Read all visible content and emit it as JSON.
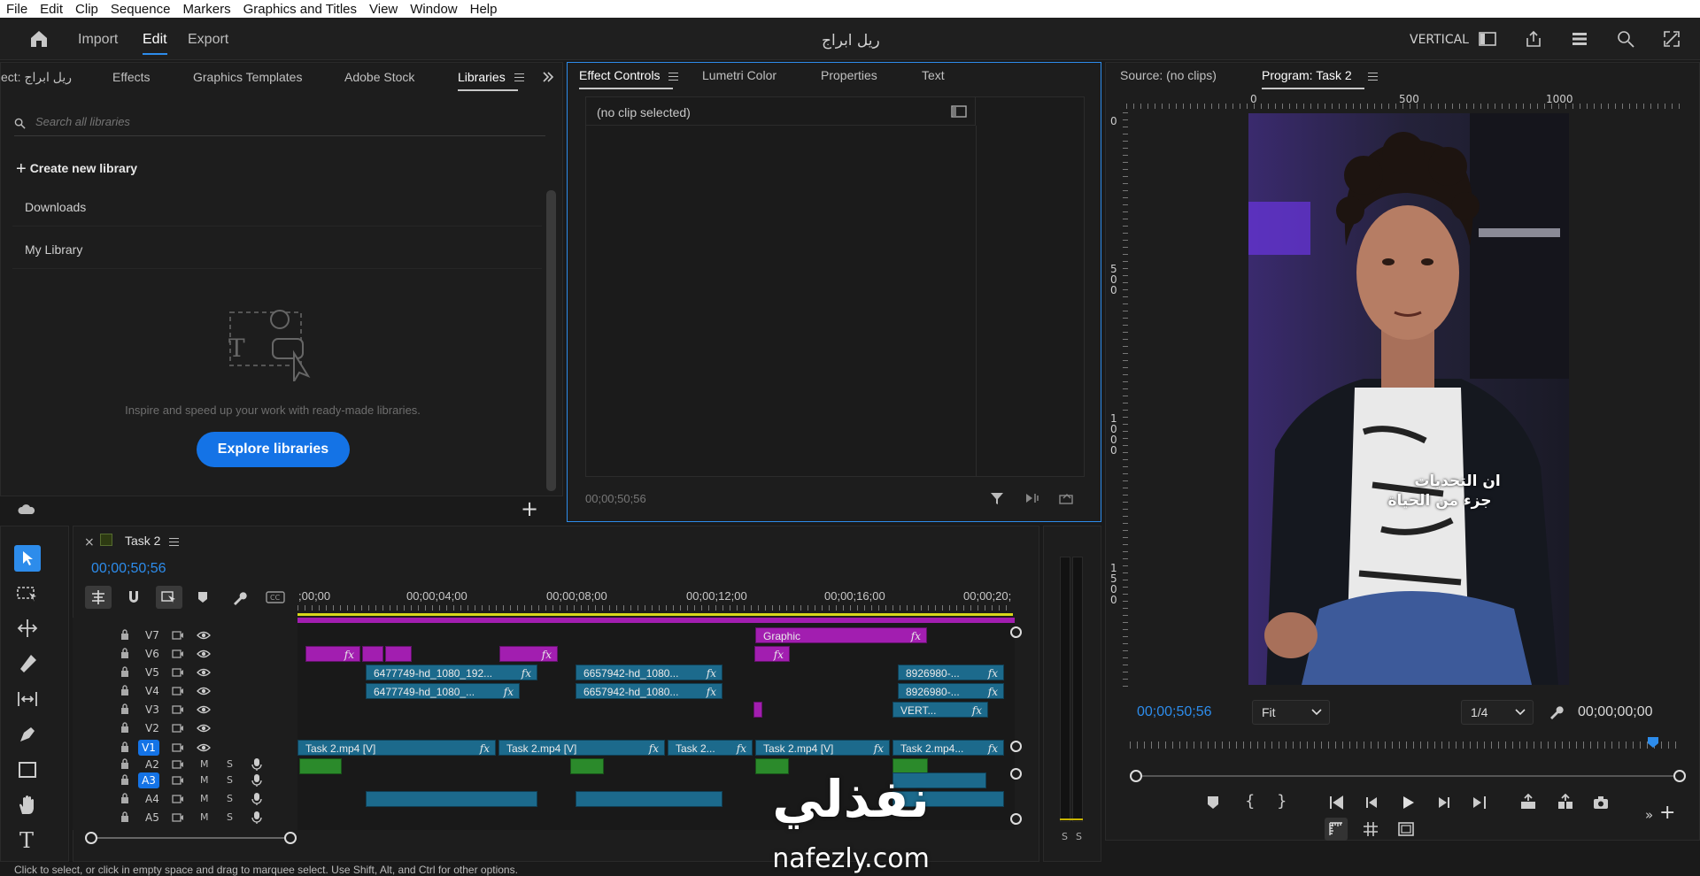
{
  "menu": [
    "File",
    "Edit",
    "Clip",
    "Sequence",
    "Markers",
    "Graphics and Titles",
    "View",
    "Window",
    "Help"
  ],
  "header": {
    "tabs": [
      "Import",
      "Edit",
      "Export"
    ],
    "active_tab": "Edit",
    "project_name": "ريل ابراج",
    "layout_label": "VERTICAL"
  },
  "left_panel": {
    "tabs": [
      "ect: ريل ابراج",
      "Effects",
      "Graphics Templates",
      "Adobe Stock",
      "Libraries"
    ],
    "active_tab": "Libraries",
    "search_placeholder": "Search all libraries",
    "create_label": "Create new library",
    "libraries": [
      "Downloads",
      "My Library"
    ],
    "empty_text": "Inspire and speed up your work with ready-made libraries.",
    "explore_button": "Explore libraries"
  },
  "effect_panel": {
    "tabs": [
      "Effect Controls",
      "Lumetri Color",
      "Properties",
      "Text"
    ],
    "active_tab": "Effect Controls",
    "no_clip": "(no clip selected)",
    "timecode": "00;00;50;56"
  },
  "monitor": {
    "tabs": [
      "Source: (no clips)",
      "Program: Task 2"
    ],
    "active_tab": "Program: Task 2",
    "ruler_h": [
      "0",
      "500",
      "1000"
    ],
    "ruler_v": [
      "0",
      "5\n0\n0",
      "1\n0\n0\n0",
      "1\n5\n0\n0"
    ],
    "caption_line1": "ان التحديات",
    "caption_line2": "جزء من الحياة",
    "current_time": "00;00;50;56",
    "fit": "Fit",
    "resolution": "1/4",
    "duration": "00;00;00;00"
  },
  "timeline": {
    "sequence_name": "Task 2",
    "timecode": "00;00;50;56",
    "ruler": [
      ";00;00",
      "00;00;04;00",
      "00;00;08;00",
      "00;00;12;00",
      "00;00;16;00",
      "00;00;20;"
    ],
    "video_tracks": [
      "V7",
      "V6",
      "V5",
      "V4",
      "V3",
      "V2",
      "V1"
    ],
    "audio_tracks": [
      "A2",
      "A3",
      "A4",
      "A5"
    ],
    "clips": {
      "graphic": "Graphic",
      "v5_a": "6477749-hd_1080_192...",
      "v5_b": "6657942-hd_1080...",
      "v5_c": "8926980-...",
      "v4_a": "6477749-hd_1080_...",
      "v4_b": "6657942-hd_1080...",
      "v4_c": "8926980-...",
      "v3_a": "VERT...",
      "v1_a": "Task 2.mp4 [V]",
      "v1_b": "Task 2.mp4 [V]",
      "v1_c": "Task 2...",
      "v1_d": "Task 2.mp4 [V]",
      "v1_e": "Task 2.mp4...",
      "fx": "fx",
      "m": "M",
      "s": "S"
    },
    "meter_labels": [
      "S",
      "S"
    ]
  },
  "status_bar": "Click to select, or click in empty space and drag to marquee select. Use Shift, Alt, and Ctrl for other options.",
  "watermark": {
    "arabic": "نفذلي",
    "url": "nafezly.com"
  },
  "colors": {
    "accent": "#2d8ceb",
    "clip_video": "#1c6a8c",
    "clip_graphic": "#a21eb0",
    "clip_audio_marker": "#2b8a2b"
  }
}
